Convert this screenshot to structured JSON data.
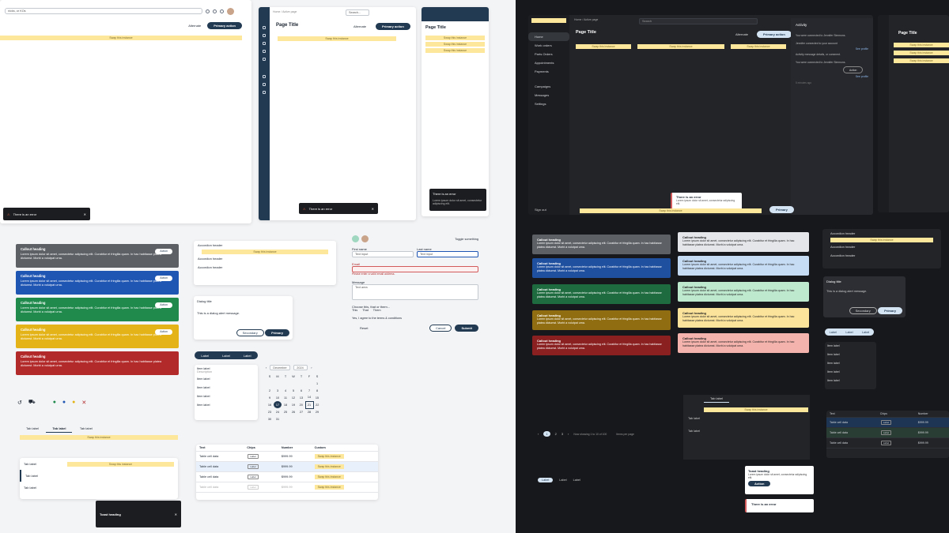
{
  "light": {
    "search_placeholder": "nicks, or KOs",
    "alternate": "Alternate",
    "primary_action": "Primary action",
    "swap": "Swap this instance",
    "error_toast": "There is an error",
    "page_title": "Page Title",
    "breadcrumb": "Home",
    "breadcrumb_active": "Active page",
    "search_short": "Search...",
    "callouts": [
      {
        "title": "Callout heading",
        "body": "Lorem ipsum dolor sit amet, consectetur adipiscing elit. Curabitur et fringilla quam. In hac habitasse platea dictumst. Morbi a volutpat urna.",
        "action": "Action",
        "color": "#5d6166"
      },
      {
        "title": "Callout heading",
        "body": "Lorem ipsum dolor sit amet, consectetur adipiscing elit. Curabitur et fringilla quam. In hac habitasse platea dictumst. Morbi a volutpat urna.",
        "action": "Action",
        "color": "#1f55b3"
      },
      {
        "title": "Callout heading",
        "body": "Lorem ipsum dolor sit amet, consectetur adipiscing elit. Curabitur et fringilla quam. In hac habitasse platea dictumst. Morbi a volutpat urna.",
        "action": "Action",
        "color": "#1f8a4c"
      },
      {
        "title": "Callout heading",
        "body": "Lorem ipsum dolor sit amet, consectetur adipiscing elit. Curabitur et fringilla quam. In hac habitasse platea dictumst. Morbi a volutpat urna.",
        "action": "Action",
        "color": "#e3b318"
      },
      {
        "title": "Callout heading",
        "body": "Lorem ipsum dolor sit amet, consectetur adipiscing elit. Curabitur et fringilla quam. In hac habitasse platea dictumst. Morbi a volutpat urna.",
        "action": "",
        "color": "#b32a2a"
      }
    ],
    "accordion": [
      "Accordion header",
      "Accordion header",
      "Accordion header",
      "Accordion header"
    ],
    "dialog": {
      "title": "Dialog title",
      "body": "This is a dialog alert message.",
      "secondary": "Secondary",
      "primary": "Primary"
    },
    "seg_tabs": [
      "Label",
      "Label",
      "Label"
    ],
    "list_items": [
      "Item label",
      "Item label",
      "Item label",
      "Item label",
      "Item label"
    ],
    "list_desc": "Description",
    "cal_month": "December",
    "cal_year": "2024",
    "cal_days": [
      "S",
      "M",
      "T",
      "W",
      "T",
      "F",
      "S"
    ],
    "cal_rows": [
      [
        "",
        "",
        "",
        "",
        "",
        "",
        "1"
      ],
      [
        "2",
        "3",
        "4",
        "5",
        "6",
        "7",
        "8"
      ],
      [
        "9",
        "10",
        "11",
        "12",
        "13",
        "14",
        "15"
      ],
      [
        "16",
        "17",
        "18",
        "19",
        "20",
        "21",
        "22"
      ],
      [
        "23",
        "24",
        "25",
        "26",
        "27",
        "28",
        "29"
      ],
      [
        "30",
        "31",
        "",
        "",
        "",
        "",
        ""
      ]
    ],
    "tabs": [
      "Tab label",
      "Tab label",
      "Tab label"
    ],
    "vtabs": [
      "Tab label",
      "Tab label",
      "Tab label"
    ],
    "toast_heading": "Toast heading",
    "table": {
      "headers": [
        "Text",
        "Chips",
        "Number",
        "Custom"
      ],
      "rows": [
        [
          "Table cell data",
          "Label",
          "$999.99",
          "Swap this instance"
        ],
        [
          "Table cell data",
          "Label",
          "$999.99",
          "Swap this instance"
        ],
        [
          "Table cell data",
          "Label",
          "$999.99",
          "Swap this instance"
        ],
        [
          "Table cell data",
          "Label",
          "$999.99",
          "Swap this instance"
        ]
      ]
    },
    "form": {
      "toggle": "Toggle something",
      "first": "First name",
      "last": "Last name",
      "first_val": "Text input",
      "last_val": "Text input",
      "email": "Email",
      "email_err": "Please enter a valid email address.",
      "message": "Message",
      "message_ph": "Text area",
      "radio_q": "Choose this, that or them...",
      "radios": [
        "This",
        "That",
        "Them"
      ],
      "agree": "Yes, I agree to the terms & conditions",
      "reset": "Reset",
      "cancel": "Cancel",
      "submit": "Submit"
    }
  },
  "dark": {
    "search": "Search",
    "swap": "Swap this instance",
    "breadcrumb": "Home",
    "breadcrumb_active": "Active page",
    "page_title": "Page Title",
    "alternate": "Alternate",
    "primary_action": "Primary action",
    "nav": [
      "Home",
      "Work orders",
      "Parts Orders",
      "Appointments",
      "Payments",
      "Campaigns",
      "Messages",
      "Settings"
    ],
    "signout": "Sign out",
    "activity": "Activity",
    "activity_items": [
      "You were connected to Jennifer Simmons.",
      "Jennifer connected to your account",
      "Activity message details, or comment.",
      "You were connected to Jennifer Simmons."
    ],
    "activity_links": [
      "See profile",
      "See profile"
    ],
    "action": "Action",
    "time": "5 minutes ago",
    "error_title": "There is an error",
    "error_body": "Lorem ipsum dolor sit amet, consectetur adipiscing elit.",
    "primary": "Primary",
    "callouts": [
      "Callout heading",
      "Callout heading",
      "Callout heading",
      "Callout heading",
      "Callout heading"
    ],
    "callout_body": "Lorem ipsum dolor sit amet, consectetur adipiscing elit. Curabitur et fringilla quam. In hac habitasse platea dictumst. Morbi a volutpat urna.",
    "accordion": [
      "Accordion header",
      "Accordion header",
      "Accordion header"
    ],
    "dialog": {
      "title": "Dialog title",
      "body": "This is a dialog alert message.",
      "secondary": "Secondary",
      "primary": "Primary"
    },
    "labels": [
      "Label",
      "Label",
      "Label"
    ],
    "items": [
      "Item label",
      "Item label",
      "Item label",
      "Item label",
      "Item label"
    ],
    "pagination": [
      "1",
      "2",
      "3"
    ],
    "pag_info": "Now showing 1 to 10 of 100",
    "per_page": "Items per page",
    "toast_heading": "Toast heading",
    "toast_body": "Lorem ipsum dolor sit amet, consectetur adipiscing elit.",
    "toast_action": "Action",
    "tab": "Tab label",
    "table_headers": [
      "Text",
      "Chips",
      "Number"
    ],
    "table_cell": "Table cell data",
    "table_num": "$999.99"
  }
}
